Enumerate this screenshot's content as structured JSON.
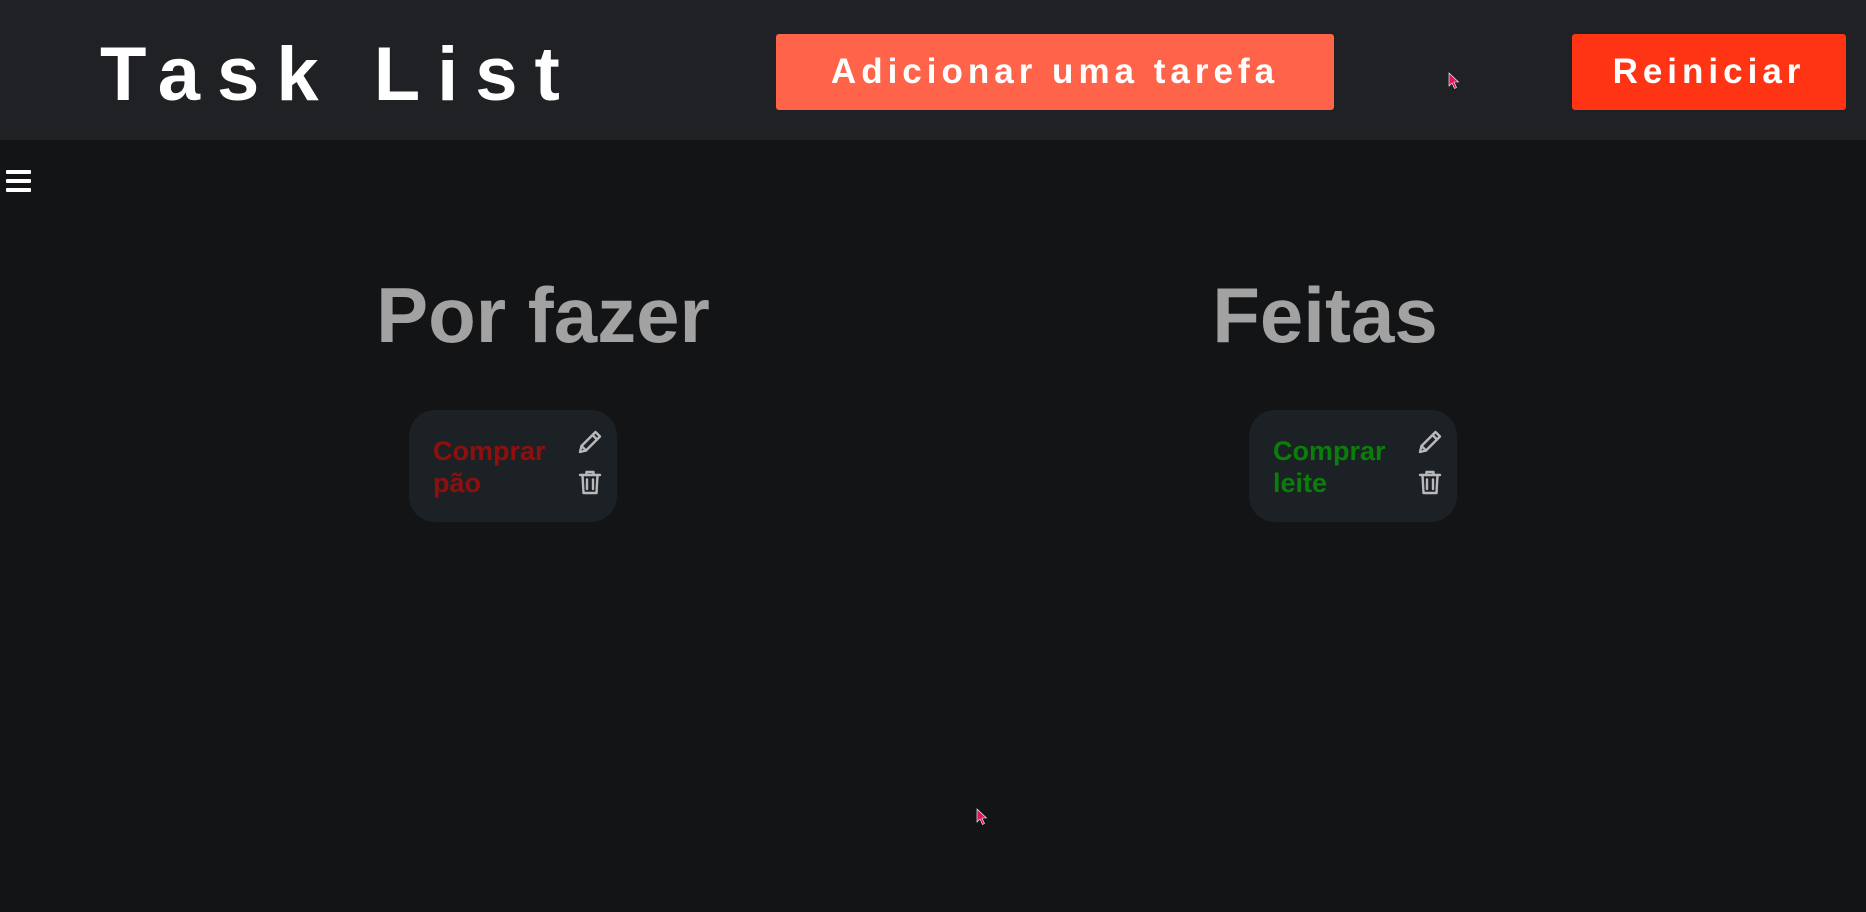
{
  "header": {
    "title": "Task List",
    "add_button_label": "Adicionar uma tarefa",
    "reset_button_label": "Reiniciar"
  },
  "columns": {
    "todo": {
      "heading": "Por fazer",
      "tasks": [
        {
          "text": "Comprar pão"
        }
      ]
    },
    "done": {
      "heading": "Feitas",
      "tasks": [
        {
          "text": "Comprar leite"
        }
      ]
    }
  },
  "icons": {
    "menu": "hamburger-menu-icon",
    "edit": "pencil-icon",
    "delete": "trash-icon"
  },
  "colors": {
    "header_bg": "#202124",
    "page_bg": "#131416",
    "add_button": "#ff634a",
    "reset_button": "#ff3414",
    "heading": "#a2a2a2",
    "card_bg": "#1c2126",
    "todo_text": "#8f0f0f",
    "done_text": "#0a7e0a"
  }
}
